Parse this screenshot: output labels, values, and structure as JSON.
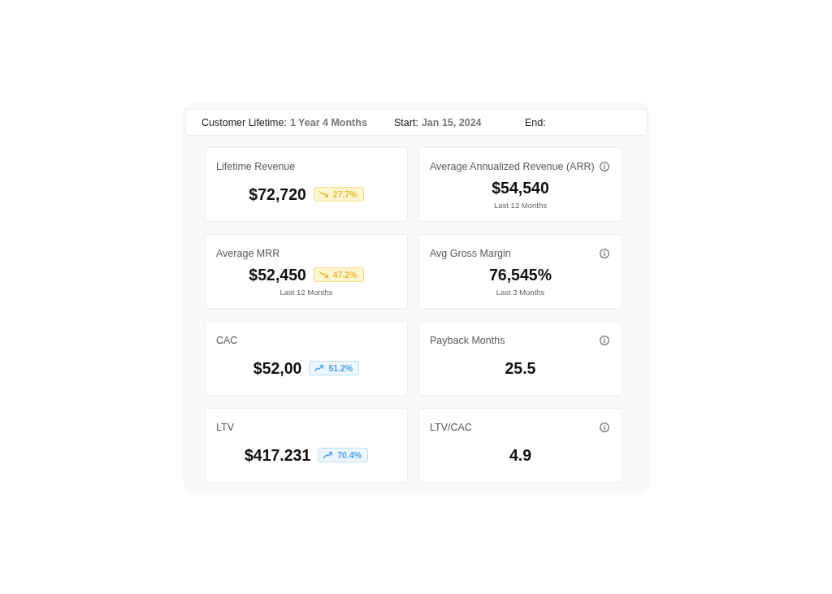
{
  "header": {
    "fields": [
      {
        "label": "Customer Lifetime:",
        "value": "1 Year 4 Months"
      },
      {
        "label": "Start:",
        "value": "Jan 15, 2024"
      },
      {
        "label": "End:"
      }
    ]
  },
  "metrics": [
    {
      "title": "Lifetime Revenue",
      "value": "$72,720",
      "info": false,
      "badge": {
        "kind": "down",
        "text": "27.7%"
      }
    },
    {
      "title": "Average Annualized Revenue (ARR)",
      "value": "$54,540",
      "info": true,
      "note": "Last 12 Months"
    },
    {
      "title": "Average MRR",
      "value": "$52,450",
      "info": false,
      "badge": {
        "kind": "down",
        "text": "47.2%"
      },
      "note": "Last 12 Months"
    },
    {
      "title": "Avg Gross Margin",
      "value": "76,545%",
      "info": true,
      "note": "Last 3 Months"
    },
    {
      "title": "CAC",
      "value": "$52,00",
      "info": false,
      "badge": {
        "kind": "up",
        "text": "51.2%"
      }
    },
    {
      "title": "Payback Months",
      "value": "25.5",
      "info": true
    },
    {
      "title": "LTV",
      "value": "$417.231",
      "info": false,
      "badge": {
        "kind": "up",
        "text": "70.4%"
      }
    },
    {
      "title": "LTV/CAC",
      "value": "4.9",
      "info": true
    }
  ]
}
